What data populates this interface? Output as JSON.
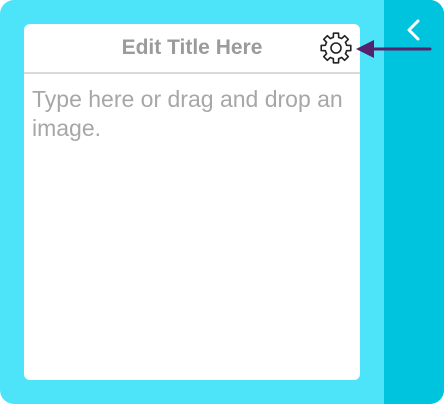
{
  "card": {
    "title": "Edit Title Here",
    "body_placeholder": "Type here or drag and drop an image."
  },
  "icons": {
    "settings": "gear-icon",
    "collapse": "chevron-left-icon",
    "annotation": "arrow-left-icon"
  },
  "colors": {
    "panel_background": "#4de3f8",
    "side_strip": "#00c3de",
    "card_background": "#ffffff",
    "title_text": "#9b9b9b",
    "placeholder_text": "#a7a7a7",
    "annotation_arrow": "#55226e"
  }
}
